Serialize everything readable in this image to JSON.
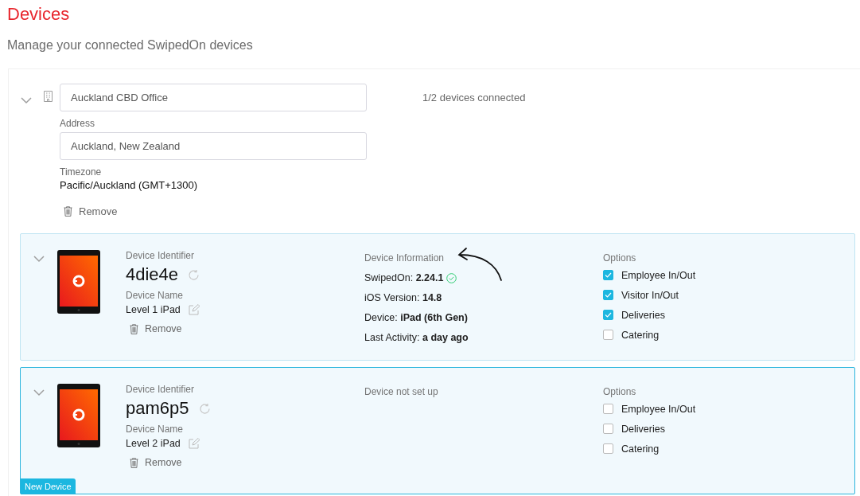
{
  "page": {
    "title": "Devices",
    "subtitle": "Manage your connected SwipedOn devices"
  },
  "location": {
    "name": "Auckland CBD Office",
    "address_label": "Address",
    "address": "Auckland, New Zealand",
    "timezone_label": "Timezone",
    "timezone": "Pacific/Auckland (GMT+1300)",
    "remove": "Remove",
    "status": "1/2 devices connected",
    "expanded": true
  },
  "devices": [
    {
      "selected": false,
      "expanded": true,
      "identifier_label": "Device Identifier",
      "identifier": "4die4e",
      "name_label": "Device Name",
      "name": "Level 1 iPad",
      "remove": "Remove",
      "info_heading": "Device Information",
      "pointer_arrow": true,
      "info": [
        {
          "text": "SwipedOn: **2.24.1**",
          "verified": true
        },
        {
          "text": "iOS Version: **14.8**",
          "verified": false
        },
        {
          "text": "Device: **iPad (6th Gen)**",
          "verified": false
        },
        {
          "text": "Last Activity: **a day ago**",
          "verified": false
        }
      ],
      "options_label": "Options",
      "options": [
        {
          "label": "Employee In/Out",
          "checked": true
        },
        {
          "label": "Visitor In/Out",
          "checked": true
        },
        {
          "label": "Deliveries",
          "checked": true
        },
        {
          "label": "Catering",
          "checked": false
        }
      ]
    },
    {
      "selected": true,
      "expanded": true,
      "identifier_label": "Device Identifier",
      "identifier": "pam6p5",
      "name_label": "Device Name",
      "name": "Level 2 iPad",
      "remove": "Remove",
      "info_heading": "Device not set up",
      "pointer_arrow": false,
      "options_label": "Options",
      "options": [
        {
          "label": "Employee In/Out",
          "checked": false
        },
        {
          "label": "Deliveries",
          "checked": false
        },
        {
          "label": "Catering",
          "checked": false
        }
      ],
      "badge": "New Device"
    }
  ]
}
